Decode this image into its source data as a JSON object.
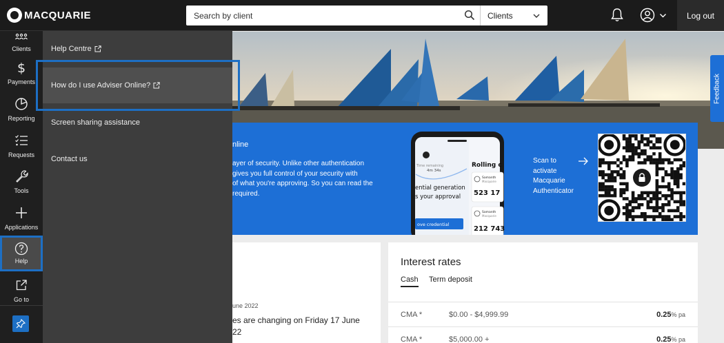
{
  "brand": {
    "name": "MACQUARIE"
  },
  "header": {
    "search_placeholder": "Search by client",
    "search_scope": "Clients",
    "logout_label": "Log out"
  },
  "nav": [
    {
      "label": "Clients",
      "icon": "clients-icon"
    },
    {
      "label": "Payments",
      "icon": "dollar-icon"
    },
    {
      "label": "Reporting",
      "icon": "pie-chart-icon"
    },
    {
      "label": "Requests",
      "icon": "checklist-icon"
    },
    {
      "label": "Tools",
      "icon": "wrench-icon"
    },
    {
      "label": "Applications",
      "icon": "plus-icon"
    },
    {
      "label": "Help",
      "icon": "help-icon",
      "active": true
    },
    {
      "label": "Go to",
      "icon": "external-link-icon"
    }
  ],
  "help_menu": {
    "items": [
      {
        "label": "Help Centre",
        "external": true
      },
      {
        "label": "How do I use Adviser Online?",
        "external": true,
        "highlighted": true
      },
      {
        "label": "Screen sharing assistance",
        "external": false
      },
      {
        "label": "Contact us",
        "external": false
      }
    ]
  },
  "promo": {
    "heading": "nline",
    "body": "ayer of security. Unlike other authentication gives you full control of your security with of what you're approving. So you can read the required.",
    "body_lines": [
      "ayer of security. Unlike other authentication",
      "gives you full control of your security with",
      "of what you're approving. So you can read the",
      "required."
    ],
    "phone": {
      "timer_label": "Time remaining",
      "timer_value": "4m 34s",
      "line1": "ential generation",
      "line2": "s your approval",
      "button": "ove credential",
      "rolling_title": "Rolling c",
      "entry_name": "Samanth",
      "entry_org": "Macquarie",
      "code1": "523 17",
      "code2": "212 743"
    },
    "scan_lines": [
      "Scan to",
      "activate",
      "Macquarie",
      "Authenticator"
    ]
  },
  "feedback_label": "Feedback",
  "news": {
    "date": "une 2022",
    "title_lines": [
      "es are changing on Friday 17 June",
      "22"
    ]
  },
  "rates": {
    "title": "Interest rates",
    "tabs": [
      {
        "label": "Cash",
        "active": true
      },
      {
        "label": "Term deposit",
        "active": false
      }
    ],
    "rows": [
      {
        "account": "CMA *",
        "range": "$0.00 - $4,999.99",
        "rate": "0.25",
        "unit": "% pa"
      },
      {
        "account": "CMA *",
        "range": "$5,000.00 +",
        "rate": "0.25",
        "unit": "% pa"
      }
    ]
  },
  "colors": {
    "accent": "#1d6fd6",
    "topbar": "#1b1b1b",
    "panel": "#3d3d3d"
  }
}
